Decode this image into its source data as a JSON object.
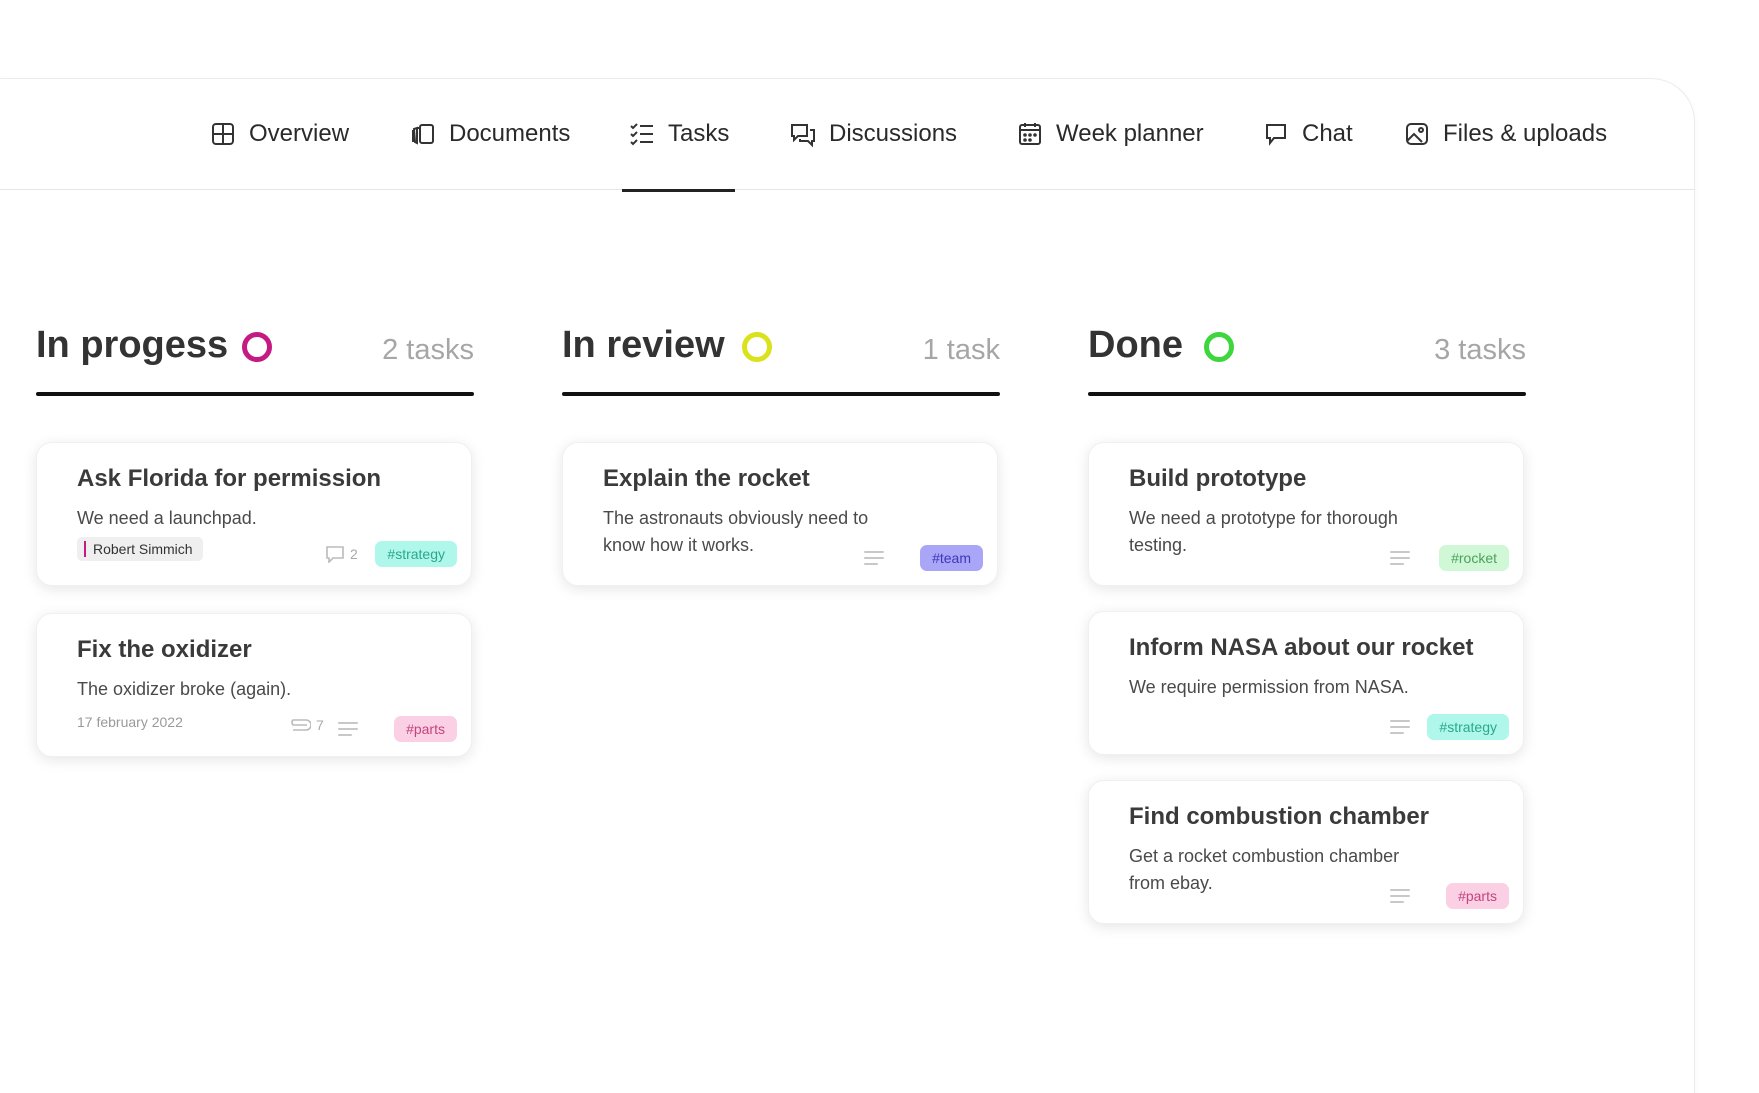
{
  "nav": {
    "items": [
      {
        "label": "Overview",
        "icon": "grid-icon"
      },
      {
        "label": "Documents",
        "icon": "documents-icon"
      },
      {
        "label": "Tasks",
        "icon": "checklist-icon",
        "active": true
      },
      {
        "label": "Discussions",
        "icon": "discussions-icon"
      },
      {
        "label": "Week planner",
        "icon": "calendar-icon"
      },
      {
        "label": "Chat",
        "icon": "chat-icon"
      },
      {
        "label": "Files & uploads",
        "icon": "image-icon"
      }
    ]
  },
  "columns": [
    {
      "title": "In progess",
      "count": "2 tasks",
      "ring_color": "#c41a82",
      "cards": [
        {
          "title": "Ask Florida for permission",
          "desc": "We need a launchpad.",
          "person": "Robert Simmich",
          "comments": "2",
          "tag": "#strategy"
        },
        {
          "title": "Fix the oxidizer",
          "desc": "The oxidizer broke (again).",
          "date": "17 february 2022",
          "attachments": "7",
          "tag": "#parts"
        }
      ]
    },
    {
      "title": "In review",
      "count": "1 task",
      "ring_color": "#d9e21a",
      "cards": [
        {
          "title": "Explain the rocket",
          "desc": "The astronauts obviously need to know how it works.",
          "tag": "#team"
        }
      ]
    },
    {
      "title": "Done",
      "count": "3 tasks",
      "ring_color": "#3dd63d",
      "cards": [
        {
          "title": "Build prototype",
          "desc": "We need a prototype for thorough testing.",
          "tag": "#rocket"
        },
        {
          "title": "Inform NASA about our rocket",
          "desc": "We require permission from NASA.",
          "tag": "#strategy"
        },
        {
          "title": "Find combustion chamber",
          "desc": "Get a rocket combustion chamber from ebay.",
          "tag": "#parts"
        }
      ]
    }
  ],
  "tag_colors": {
    "#strategy": {
      "bg": "#aff7ea",
      "fg": "#2aa88f"
    },
    "#parts": {
      "bg": "#fbd0e4",
      "fg": "#c2447e"
    },
    "#team": {
      "bg": "#a9a6f7",
      "fg": "#3d38b8"
    },
    "#rocket": {
      "bg": "#d0f7d6",
      "fg": "#4aa25b"
    }
  }
}
